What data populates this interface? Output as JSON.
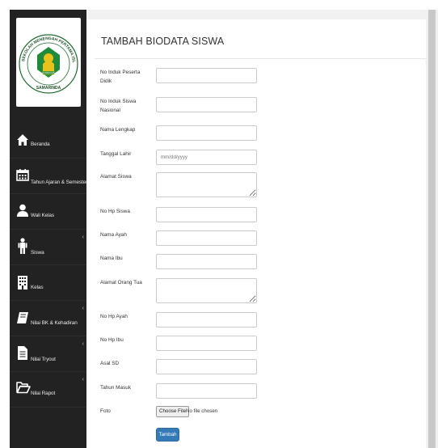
{
  "sidebar": {
    "logo": {
      "top_arc_text": "SEKOLAH MENENGAH PERTAMA ISLAM TERPADU",
      "bottom_text": "SAMARINDA",
      "center_text": "CORDOVA"
    },
    "items": [
      {
        "label": "Beranda",
        "icon": "home-icon",
        "has_caret": false
      },
      {
        "label": "Tahun Ajaran & Semester",
        "icon": "calendar-icon",
        "has_caret": false
      },
      {
        "label": "Wali Kelas",
        "icon": "user-icon",
        "has_caret": false
      },
      {
        "label": "Siswa",
        "icon": "child-icon",
        "has_caret": true
      },
      {
        "label": "Kelas",
        "icon": "building-icon",
        "has_caret": false
      },
      {
        "label": "Nilai BK & Kehadiran",
        "icon": "book-icon",
        "has_caret": true
      },
      {
        "label": "Nilai Tryout",
        "icon": "file-icon",
        "has_caret": true
      },
      {
        "label": "Nilai Rapot",
        "icon": "folder-open-icon",
        "has_caret": true
      }
    ],
    "caret": "‹"
  },
  "main": {
    "title": "TAMBAH BIODATA SISWA",
    "fields": [
      {
        "label": "No Induk Peserta Didik",
        "type": "text",
        "value": "",
        "placeholder": ""
      },
      {
        "label": "No Induk Siswa Nasional",
        "type": "text",
        "value": "",
        "placeholder": ""
      },
      {
        "label": "Nama Lengkap",
        "type": "text",
        "value": "",
        "placeholder": ""
      },
      {
        "label": "Tanggal Lahir",
        "type": "date",
        "value": "",
        "placeholder": "mm/dd/yyyy"
      },
      {
        "label": "Alamat Siswa",
        "type": "textarea",
        "value": "",
        "placeholder": ""
      },
      {
        "label": "No Hp Siswa",
        "type": "text",
        "value": "",
        "placeholder": ""
      },
      {
        "label": "Nama Ayah",
        "type": "text",
        "value": "",
        "placeholder": ""
      },
      {
        "label": "Nama Ibu",
        "type": "text",
        "value": "",
        "placeholder": ""
      },
      {
        "label": "Alamat Orang Tua",
        "type": "textarea",
        "value": "",
        "placeholder": ""
      },
      {
        "label": "No Hp Ayah",
        "type": "text",
        "value": "",
        "placeholder": ""
      },
      {
        "label": "No Hp Ibu",
        "type": "text",
        "value": "",
        "placeholder": ""
      },
      {
        "label": "Asal SD",
        "type": "text",
        "value": "",
        "placeholder": ""
      },
      {
        "label": "Tahun Masuk",
        "type": "text",
        "value": "",
        "placeholder": ""
      }
    ],
    "photo": {
      "label": "Foto",
      "button_label": "Choose File",
      "status_text": "No file chosen"
    },
    "submit_label": "Tambah"
  },
  "colors": {
    "sidebar_bg": "#222222",
    "submit_bg": "#337ab7",
    "logo_green": "#1e8a3a",
    "logo_yellow": "#e8c21b"
  }
}
